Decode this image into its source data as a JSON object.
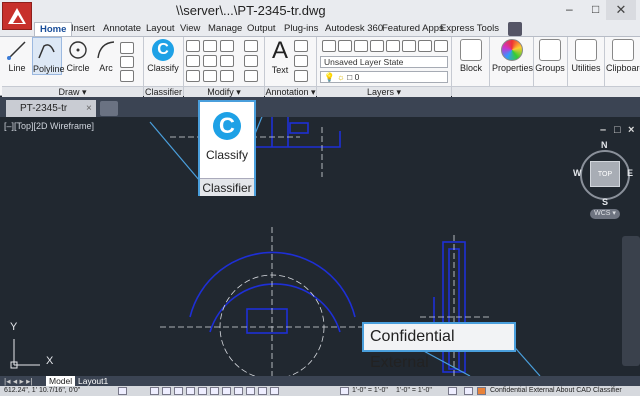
{
  "window": {
    "title": "\\\\server\\...\\PT-2345-tr.dwg",
    "minimize": "–",
    "maximize": "□",
    "close": "✕"
  },
  "ribbon_tabs": [
    "Home",
    "Insert",
    "Annotate",
    "Layout",
    "View",
    "Manage",
    "Output",
    "Plug-ins",
    "Autodesk 360",
    "Featured Apps",
    "Express Tools"
  ],
  "active_tab": "Home",
  "tools": {
    "line": "Line",
    "polyline": "Polyline",
    "circle": "Circle",
    "arc": "Arc",
    "classify": "Classify",
    "text": "Text",
    "block": "Block",
    "properties": "Properties",
    "groups": "Groups",
    "utilities": "Utilities",
    "clipboard": "Clipboard"
  },
  "layer_state": "Unsaved Layer State",
  "layer_value": "0",
  "panels": {
    "draw": "Draw ▾",
    "classifier": "Classifier",
    "modify": "Modify ▾",
    "annotation": "Annotation ▾",
    "layers": "Layers ▾"
  },
  "doc_tab": {
    "name": "PT-2345-tr",
    "close": "×"
  },
  "viewport_label": "[–][Top][2D Wireframe]",
  "viewport_controls": {
    "minimize": "–",
    "restore": "□",
    "close": "×"
  },
  "viewcube": {
    "north": "N",
    "south": "S",
    "east": "E",
    "west": "W",
    "face": "TOP",
    "wcs": "WCS ▾"
  },
  "classify_popup": {
    "label": "Classify",
    "footer": "Classifier",
    "icon": "C"
  },
  "confidential_popup": "Confidential External",
  "ucs": {
    "x": "X",
    "y": "Y"
  },
  "layout_tabs": [
    "Model",
    "Layout1"
  ],
  "status": {
    "coords": "612.24\", 1' 10.7/16\", 0'0\"",
    "scale": "1'-0\" = 1'-0\"",
    "scale2": "1'-0\" = 1'-0\"",
    "classification": "Confidential External",
    "about": "About CAD Classifier"
  },
  "colors": {
    "drawing_blue": "#1e2fd6",
    "callout_border": "#4a9fdc",
    "canvas": "#212830"
  }
}
